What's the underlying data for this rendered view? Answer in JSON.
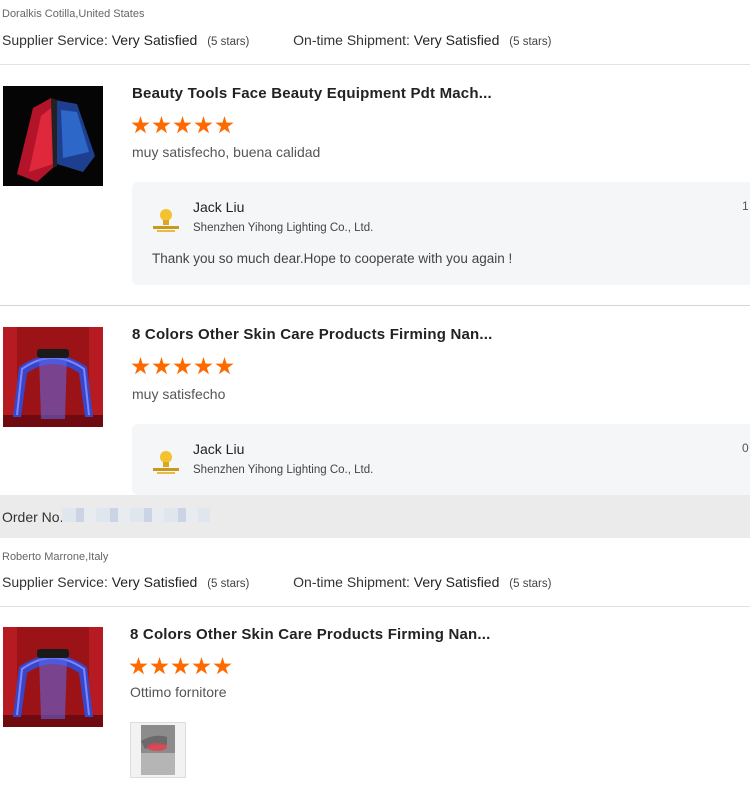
{
  "reviews": [
    {
      "buyer": "Doralkis Cotilla,United States",
      "supplier_service_label": "Supplier Service:",
      "supplier_service_value": "Very Satisfied",
      "supplier_service_stars": "(5 stars)",
      "shipment_label": "On-time Shipment:",
      "shipment_value": "Very Satisfied",
      "shipment_stars": "(5 stars)",
      "items": [
        {
          "title": "Beauty Tools Face Beauty Equipment Pdt Mach...",
          "rating": 5,
          "comment": "muy satisfecho, buena calidad",
          "reply": {
            "name": "Jack Liu",
            "company": "Shenzhen Yihong Lighting Co., Ltd.",
            "message": "Thank you so much dear.Hope to cooperate with you again !",
            "date_fragment": "1"
          }
        },
        {
          "title": "8 Colors Other Skin Care Products Firming Nan...",
          "rating": 5,
          "comment": "muy satisfecho",
          "reply": {
            "name": "Jack Liu",
            "company": "Shenzhen Yihong Lighting Co., Ltd.",
            "date_fragment": "0"
          }
        }
      ]
    }
  ],
  "order": {
    "label": "Order No."
  },
  "review2": {
    "buyer": "Roberto Marrone,Italy",
    "supplier_service_label": "Supplier Service:",
    "supplier_service_value": "Very Satisfied",
    "supplier_service_stars": "(5 stars)",
    "shipment_label": "On-time Shipment:",
    "shipment_value": "Very Satisfied",
    "shipment_stars": "(5 stars)",
    "item": {
      "title": "8 Colors Other Skin Care Products Firming Nan...",
      "rating": 5,
      "comment": "Ottimo fornitore"
    }
  },
  "colors": {
    "star": "#ff6a00",
    "reply_bg": "#f5f6f8",
    "order_bar": "#ebebeb"
  }
}
